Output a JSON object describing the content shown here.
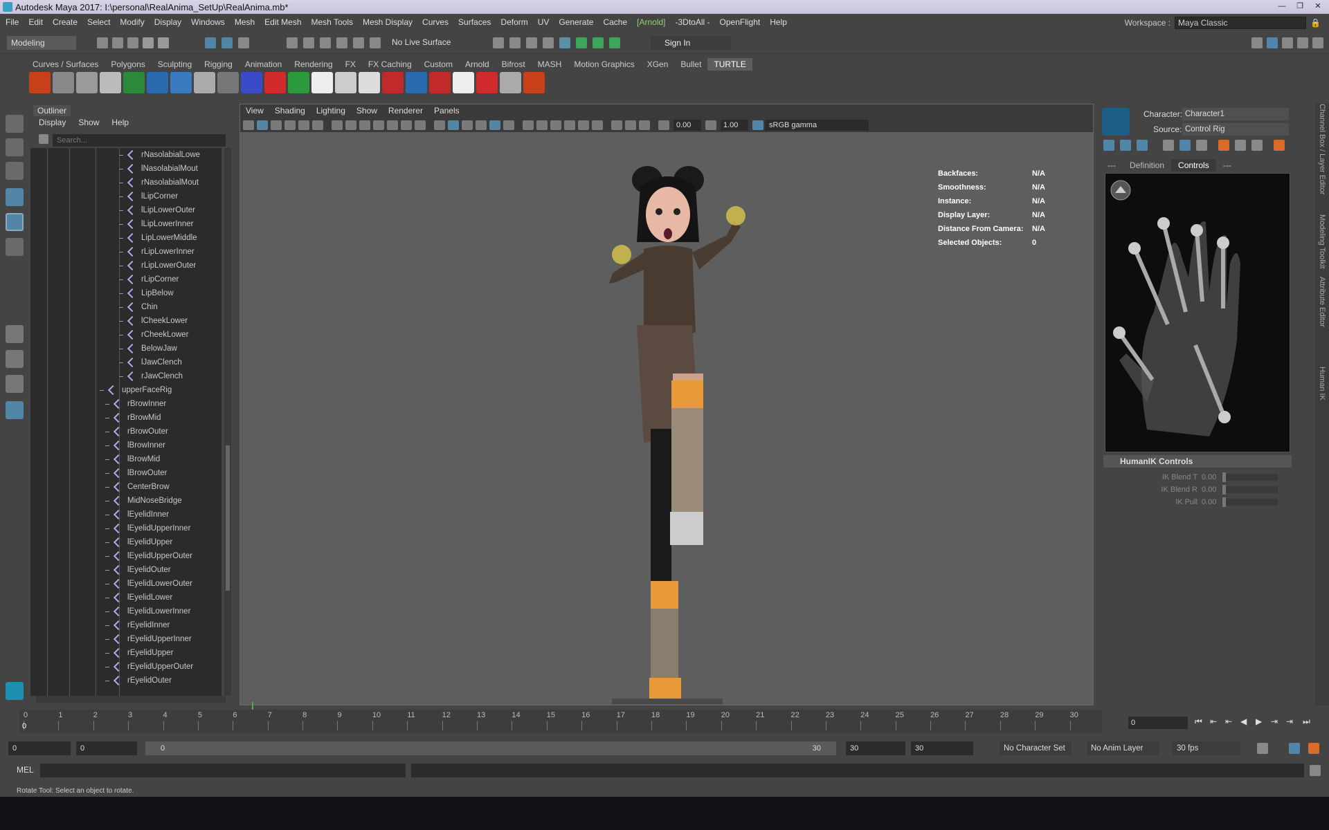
{
  "window": {
    "title": "Autodesk Maya 2017: I:\\personal\\RealAnima_SetUp\\RealAnima.mb*"
  },
  "menubar": [
    "File",
    "Edit",
    "Create",
    "Select",
    "Modify",
    "Display",
    "Windows",
    "Mesh",
    "Edit Mesh",
    "Mesh Tools",
    "Mesh Display",
    "Curves",
    "Surfaces",
    "Deform",
    "UV",
    "Generate",
    "Cache",
    "[Arnold]",
    "-3DtoAll -",
    "OpenFlight",
    "Help"
  ],
  "workspace": {
    "label": "Workspace :",
    "value": "Maya Classic"
  },
  "status": {
    "mode": "Modeling",
    "live_surface": "No Live Surface",
    "signin": "Sign In"
  },
  "shelf_tabs": [
    "Curves / Surfaces",
    "Polygons",
    "Sculpting",
    "Rigging",
    "Animation",
    "Rendering",
    "FX",
    "FX Caching",
    "Custom",
    "Arnold",
    "Bifrost",
    "MASH",
    "Motion Graphics",
    "XGen",
    "Bullet",
    "TURTLE"
  ],
  "shelf_active": "TURTLE",
  "outliner": {
    "title": "Outliner",
    "menu": [
      "Display",
      "Show",
      "Help"
    ],
    "search_placeholder": "Search...",
    "rows": [
      {
        "label": "rNasolabialLowe",
        "indent": 2
      },
      {
        "label": "lNasolabialMout",
        "indent": 2
      },
      {
        "label": "rNasolabialMout",
        "indent": 2
      },
      {
        "label": "lLipCorner",
        "indent": 2
      },
      {
        "label": "lLipLowerOuter",
        "indent": 2
      },
      {
        "label": "lLipLowerInner",
        "indent": 2
      },
      {
        "label": "LipLowerMiddle",
        "indent": 2
      },
      {
        "label": "rLipLowerInner",
        "indent": 2
      },
      {
        "label": "rLipLowerOuter",
        "indent": 2
      },
      {
        "label": "rLipCorner",
        "indent": 2
      },
      {
        "label": "LipBelow",
        "indent": 2
      },
      {
        "label": "Chin",
        "indent": 2
      },
      {
        "label": "lCheekLower",
        "indent": 2
      },
      {
        "label": "rCheekLower",
        "indent": 2
      },
      {
        "label": "BelowJaw",
        "indent": 2
      },
      {
        "label": "lJawClench",
        "indent": 2
      },
      {
        "label": "rJawClench",
        "indent": 2
      },
      {
        "label": "upperFaceRig",
        "indent": 0
      },
      {
        "label": "rBrowInner",
        "indent": 1
      },
      {
        "label": "rBrowMid",
        "indent": 1
      },
      {
        "label": "rBrowOuter",
        "indent": 1
      },
      {
        "label": "lBrowInner",
        "indent": 1
      },
      {
        "label": "lBrowMid",
        "indent": 1
      },
      {
        "label": "lBrowOuter",
        "indent": 1
      },
      {
        "label": "CenterBrow",
        "indent": 1
      },
      {
        "label": "MidNoseBridge",
        "indent": 1
      },
      {
        "label": "lEyelidInner",
        "indent": 1
      },
      {
        "label": "lEyelidUpperInner",
        "indent": 1
      },
      {
        "label": "lEyelidUpper",
        "indent": 1
      },
      {
        "label": "lEyelidUpperOuter",
        "indent": 1
      },
      {
        "label": "lEyelidOuter",
        "indent": 1
      },
      {
        "label": "lEyelidLowerOuter",
        "indent": 1
      },
      {
        "label": "lEyelidLower",
        "indent": 1
      },
      {
        "label": "lEyelidLowerInner",
        "indent": 1
      },
      {
        "label": "rEyelidInner",
        "indent": 1
      },
      {
        "label": "rEyelidUpperInner",
        "indent": 1
      },
      {
        "label": "rEyelidUpper",
        "indent": 1
      },
      {
        "label": "rEyelidUpperOuter",
        "indent": 1
      },
      {
        "label": "rEyelidOuter",
        "indent": 1
      }
    ]
  },
  "viewport": {
    "menu": [
      "View",
      "Shading",
      "Lighting",
      "Show",
      "Renderer",
      "Panels"
    ],
    "exposure": "0.00",
    "gamma_val": "1.00",
    "color_space": "sRGB gamma",
    "hud": [
      {
        "k": "Backfaces:",
        "v": "N/A"
      },
      {
        "k": "Smoothness:",
        "v": "N/A"
      },
      {
        "k": "Instance:",
        "v": "N/A"
      },
      {
        "k": "Display Layer:",
        "v": "N/A"
      },
      {
        "k": "Distance From Camera:",
        "v": "N/A"
      },
      {
        "k": "Selected Objects:",
        "v": "0"
      }
    ],
    "camera": "persp"
  },
  "humanik": {
    "character_label": "Character:",
    "character": "Character1",
    "source_label": "Source:",
    "source": "Control Rig",
    "tabs": [
      "---",
      "Definition",
      "Controls",
      "---"
    ],
    "active_tab": "Controls",
    "section": "HumanIK Controls",
    "sliders": [
      {
        "label": "IK Blend T",
        "value": "0.00"
      },
      {
        "label": "IK Blend R",
        "value": "0.00"
      },
      {
        "label": "IK Pull",
        "value": "0.00"
      }
    ]
  },
  "side_tabs": [
    "Channel Box / Layer Editor",
    "Modeling Toolkit",
    "Attribute Editor",
    "Human IK"
  ],
  "timeline": {
    "ticks": [
      "0",
      "1",
      "2",
      "3",
      "4",
      "5",
      "6",
      "7",
      "8",
      "9",
      "10",
      "11",
      "12",
      "13",
      "14",
      "15",
      "16",
      "17",
      "18",
      "19",
      "20",
      "21",
      "22",
      "23",
      "24",
      "25",
      "26",
      "27",
      "28",
      "29",
      "30"
    ],
    "current": "0",
    "current_field": "0"
  },
  "range": {
    "start": "0",
    "anim_start": "0",
    "slider_start": "0",
    "slider_end": "30",
    "anim_end": "30",
    "end": "30",
    "character_set": "No Character Set",
    "anim_layer": "No Anim Layer",
    "fps": "30 fps"
  },
  "cmd": {
    "label": "MEL"
  },
  "help_line": "Rotate Tool: Select an object to rotate.",
  "colors": {
    "accent": "#5285a6",
    "bg": "#444444",
    "dark": "#2b2b2b",
    "joint": "#b9a6e8",
    "arnold": "#8fd46b"
  }
}
